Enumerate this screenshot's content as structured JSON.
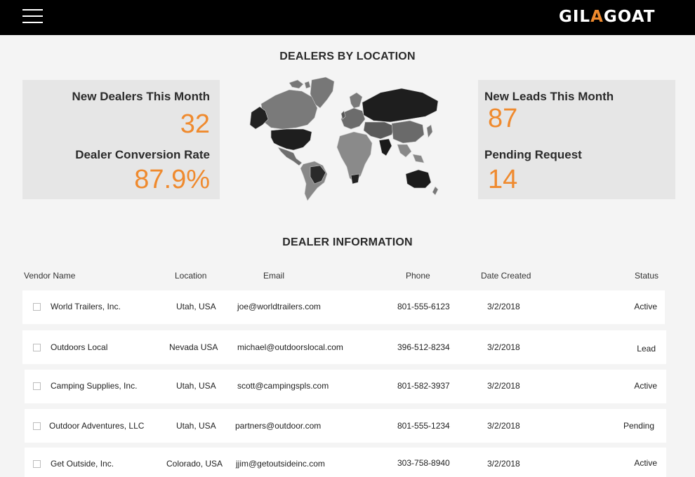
{
  "header": {
    "menu_icon": "hamburger-menu-icon",
    "logo": {
      "part1": "GIL",
      "accent": "A",
      "part2": "GOAT"
    }
  },
  "colors": {
    "accent": "#ef8a2e",
    "topbar": "#000000",
    "card_bg": "#e6e6e6",
    "page_bg": "#f4f4f4"
  },
  "dealers_by_location": {
    "title": "DEALERS BY LOCATION",
    "left_card": {
      "new_dealers_label": "New Dealers This Month",
      "new_dealers_value": "32",
      "conversion_label": "Dealer Conversion Rate",
      "conversion_value": "87.9%"
    },
    "right_card": {
      "new_leads_label": "New Leads This Month",
      "new_leads_value": "87",
      "pending_label": "Pending Request",
      "pending_value": "14"
    },
    "map_icon": "world-map"
  },
  "dealer_information": {
    "title": "DEALER INFORMATION",
    "columns": {
      "vendor": "Vendor Name",
      "location": "Location",
      "email": "Email",
      "phone": "Phone",
      "date": "Date Created",
      "status": "Status"
    },
    "rows": [
      {
        "vendor": "World Trailers, Inc.",
        "location": "Utah, USA",
        "email": "joe@worldtrailers.com",
        "phone": "801-555-6123",
        "date": "3/2/2018",
        "status": "Active"
      },
      {
        "vendor": "Outdoors Local",
        "location": "Nevada USA",
        "email": "michael@outdoorslocal.com",
        "phone": "396-512-8234",
        "date": "3/2/2018",
        "status": "Lead"
      },
      {
        "vendor": "Camping Supplies, Inc.",
        "location": "Utah, USA",
        "email": "scott@campingspls.com",
        "phone": "801-582-3937",
        "date": "3/2/2018",
        "status": "Active"
      },
      {
        "vendor": "Outdoor Adventures, LLC",
        "location": "Utah, USA",
        "email": "partners@outdoor.com",
        "phone": "801-555-1234",
        "date": "3/2/2018",
        "status": "Pending"
      },
      {
        "vendor": "Get Outside, Inc.",
        "location": "Colorado, USA",
        "email": "jjim@getoutsideinc.com",
        "phone": "303-758-8940",
        "date": "3/2/2018",
        "status": "Active"
      }
    ]
  }
}
